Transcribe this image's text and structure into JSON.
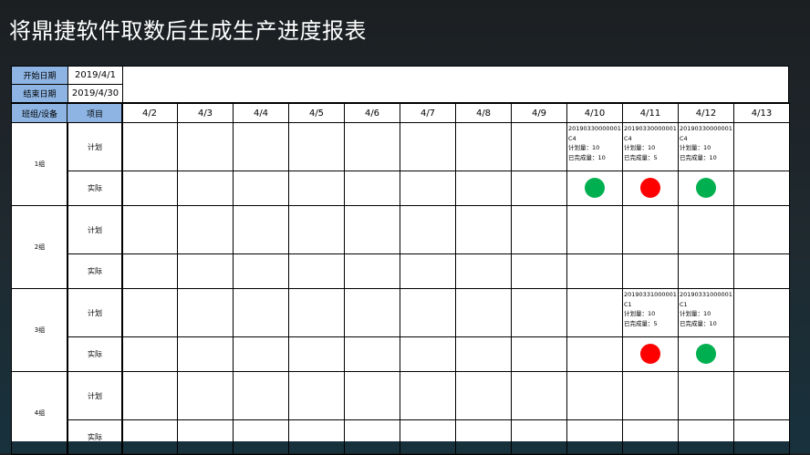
{
  "title": "将鼎捷软件取数后生成生产进度报表",
  "start": {
    "label": "开始日期",
    "value": "2019/4/1"
  },
  "end": {
    "label": "结束日期",
    "value": "2019/4/30"
  },
  "headers": {
    "group": "班组/设备",
    "item": "项目"
  },
  "dates": [
    "4/2",
    "4/3",
    "4/4",
    "4/5",
    "4/6",
    "4/7",
    "4/8",
    "4/9",
    "4/10",
    "4/11",
    "4/12",
    "4/13"
  ],
  "groups": [
    {
      "name": "1组",
      "plan_label": "计划",
      "actual_label": "实际"
    },
    {
      "name": "2组",
      "plan_label": "计划",
      "actual_label": "实际"
    },
    {
      "name": "3组",
      "plan_label": "计划",
      "actual_label": "实际"
    },
    {
      "name": "4组",
      "plan_label": "计划",
      "actual_label": "实际"
    }
  ],
  "plans": [
    {
      "group": 0,
      "date": 8,
      "order": "20190330000001",
      "product": "C4",
      "plan": "计划量：10",
      "done": "已完成量：10",
      "status": "green"
    },
    {
      "group": 0,
      "date": 9,
      "order": "20190330000001",
      "product": "C4",
      "plan": "计划量：10",
      "done": "已完成量：5",
      "status": "red"
    },
    {
      "group": 0,
      "date": 10,
      "order": "20190330000001",
      "product": "C4",
      "plan": "计划量：10",
      "done": "已完成量：10",
      "status": "green"
    },
    {
      "group": 2,
      "date": 9,
      "order": "20190331000001",
      "product": "C1",
      "plan": "计划量：10",
      "done": "已完成量：5",
      "status": "red"
    },
    {
      "group": 2,
      "date": 10,
      "order": "20190331000001",
      "product": "C1",
      "plan": "计划量：10",
      "done": "已完成量：10",
      "status": "green"
    }
  ],
  "colors": {
    "header_fill": "#8db4e2",
    "green": "#00b050",
    "red": "#ff0000"
  }
}
